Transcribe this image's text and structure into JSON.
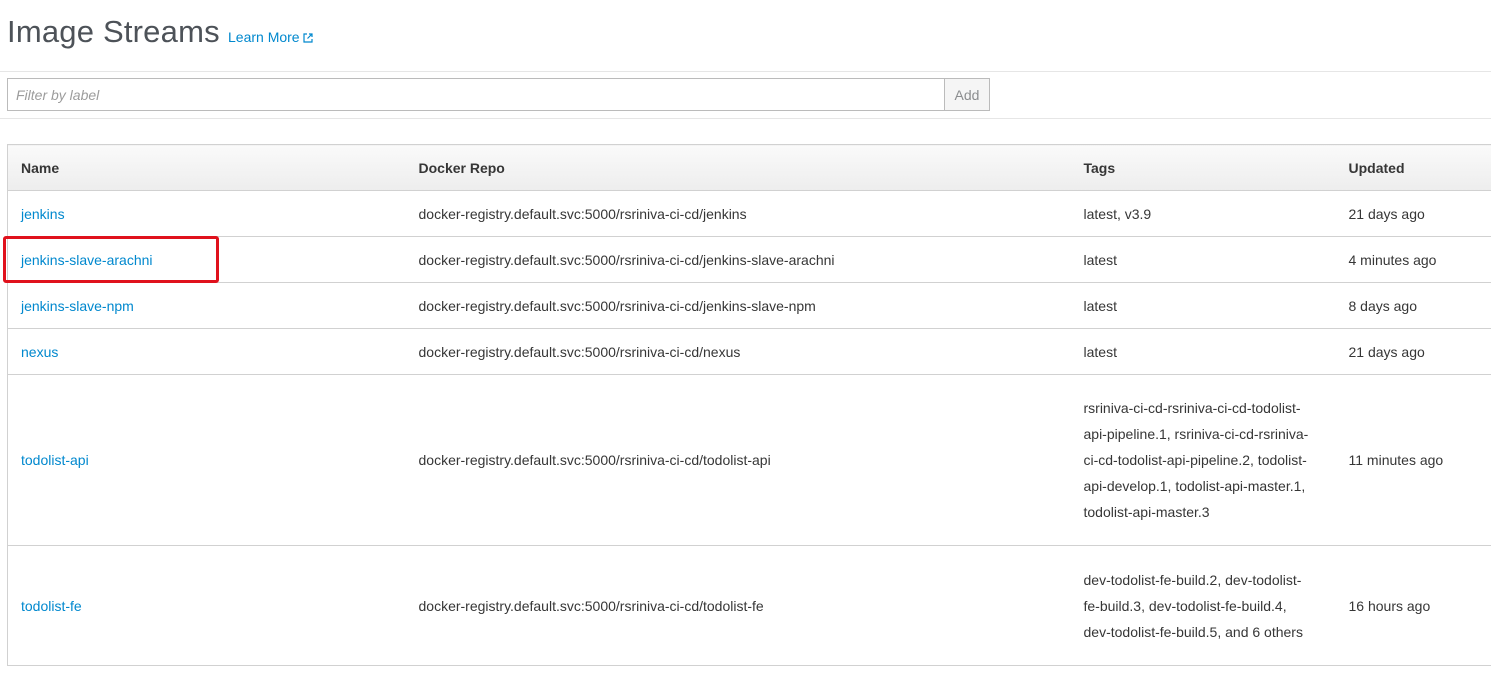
{
  "header": {
    "title": "Image Streams",
    "learn_more": "Learn More"
  },
  "filter": {
    "placeholder": "Filter by label",
    "add_label": "Add"
  },
  "table": {
    "columns": [
      "Name",
      "Docker Repo",
      "Tags",
      "Updated"
    ],
    "rows": [
      {
        "name": "jenkins",
        "repo": "docker-registry.default.svc:5000/rsriniva-ci-cd/jenkins",
        "tags": "latest, v3.9",
        "updated": "21 days ago"
      },
      {
        "name": "jenkins-slave-arachni",
        "repo": "docker-registry.default.svc:5000/rsriniva-ci-cd/jenkins-slave-arachni",
        "tags": "latest",
        "updated": "4 minutes ago"
      },
      {
        "name": "jenkins-slave-npm",
        "repo": "docker-registry.default.svc:5000/rsriniva-ci-cd/jenkins-slave-npm",
        "tags": "latest",
        "updated": "8 days ago"
      },
      {
        "name": "nexus",
        "repo": "docker-registry.default.svc:5000/rsriniva-ci-cd/nexus",
        "tags": "latest",
        "updated": "21 days ago"
      },
      {
        "name": "todolist-api",
        "repo": "docker-registry.default.svc:5000/rsriniva-ci-cd/todolist-api",
        "tags": "rsriniva-ci-cd-rsriniva-ci-cd-todolist-api-pipeline.1, rsriniva-ci-cd-rsriniva-ci-cd-todolist-api-pipeline.2, todolist-api-develop.1, todolist-api-master.1, todolist-api-master.3",
        "updated": "11 minutes ago"
      },
      {
        "name": "todolist-fe",
        "repo": "docker-registry.default.svc:5000/rsriniva-ci-cd/todolist-fe",
        "tags": "dev-todolist-fe-build.2, dev-todolist-fe-build.3, dev-todolist-fe-build.4, dev-todolist-fe-build.5, and 6 others",
        "updated": "16 hours ago"
      }
    ]
  },
  "colors": {
    "link": "#0088ce",
    "highlight": "#e0111c",
    "title": "#4d5258"
  },
  "icons": {
    "external_link": "external-link-icon"
  }
}
